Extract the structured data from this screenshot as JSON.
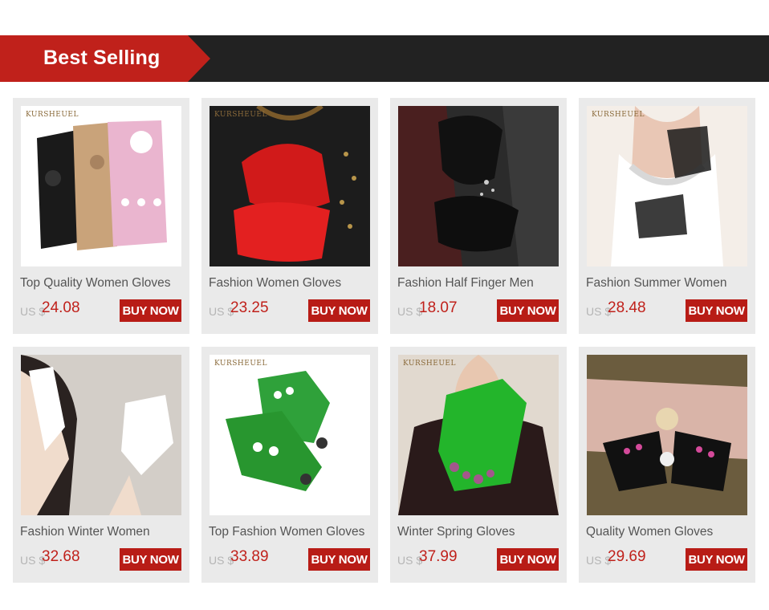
{
  "banner": {
    "title": "Best Selling"
  },
  "currency_label": "US $",
  "buy_label": "BUY NOW",
  "products": [
    {
      "name": "Top Quality Women Gloves",
      "price": "24.08",
      "brand": "KURSHEUEL"
    },
    {
      "name": "Fashion Women Gloves",
      "price": "23.25",
      "brand": "KURSHEUEL"
    },
    {
      "name": "Fashion Half Finger Men",
      "price": "18.07",
      "brand": ""
    },
    {
      "name": "Fashion Summer Women",
      "price": "28.48",
      "brand": "KURSHEUEL"
    },
    {
      "name": "Fashion Winter Women",
      "price": "32.68",
      "brand": ""
    },
    {
      "name": "Top Fashion Women Gloves",
      "price": "33.89",
      "brand": "KURSHEUEL"
    },
    {
      "name": "Winter Spring Gloves",
      "price": "37.99",
      "brand": "KURSHEUEL"
    },
    {
      "name": "Quality Women Gloves",
      "price": "29.69",
      "brand": ""
    }
  ]
}
